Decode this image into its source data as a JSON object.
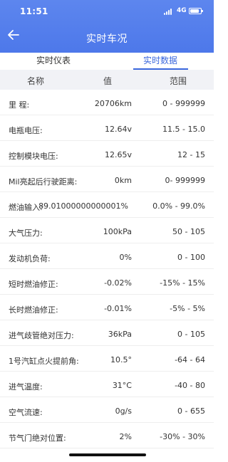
{
  "status_bar": {
    "time": "11:51",
    "network": "4G"
  },
  "header": {
    "title": "实时车况"
  },
  "tabs": [
    {
      "label": "实时仪表",
      "active": false
    },
    {
      "label": "实时数据",
      "active": true
    }
  ],
  "columns": {
    "name": "名称",
    "value": "值",
    "range": "范围"
  },
  "rows": [
    {
      "name": "里 程:",
      "value": "20706km",
      "range": "0 - 999999"
    },
    {
      "name": "电瓶电压:",
      "value": "12.64v",
      "range": "11.5 - 15.0"
    },
    {
      "name": "控制模块电压:",
      "value": "12.65v",
      "range": "12 - 15"
    },
    {
      "name": "Mil亮起后行驶距离:",
      "value": "0km",
      "range": "0- 999999"
    },
    {
      "name": "燃油输入:",
      "value": "89.01000000000001%",
      "range": "0.0% - 99.0%"
    },
    {
      "name": "大气压力:",
      "value": "100kPa",
      "range": "50 - 105"
    },
    {
      "name": "发动机负荷:",
      "value": "0%",
      "range": "0 - 100"
    },
    {
      "name": "短时燃油修正:",
      "value": "-0.02%",
      "range": "-15% - 15%"
    },
    {
      "name": "长时燃油修正:",
      "value": "-0.01%",
      "range": "-5% - 5%"
    },
    {
      "name": "进气歧管绝对压力:",
      "value": "36kPa",
      "range": "0 - 105"
    },
    {
      "name": "1号汽缸点火提前角:",
      "value": "10.5°",
      "range": "-64 - 64"
    },
    {
      "name": "进气温度:",
      "value": "31°C",
      "range": "-40 - 80"
    },
    {
      "name": "空气流速:",
      "value": "0g/s",
      "range": "0 - 655"
    },
    {
      "name": "节气门绝对位置:",
      "value": "2%",
      "range": "-30% - 30%"
    }
  ],
  "colors": {
    "header": "#4d78ea",
    "accent": "#3a67dd"
  }
}
